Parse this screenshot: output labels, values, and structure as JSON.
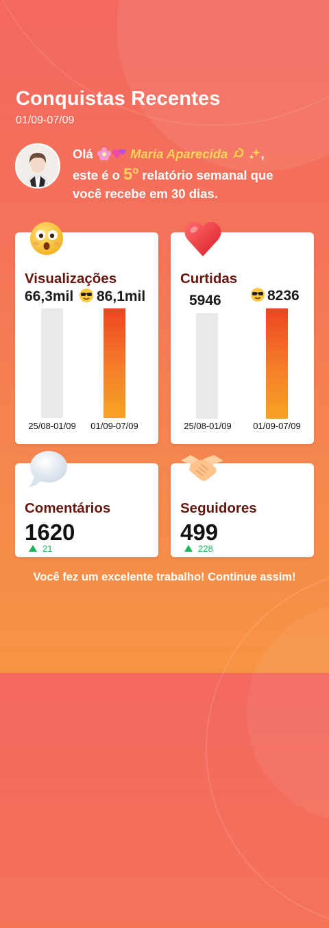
{
  "header": {
    "title": "Conquistas Recentes",
    "date_range": "01/09-07/09"
  },
  "greeting": {
    "hello": "Olá",
    "user_name": "Maria Aparecida",
    "line2_prefix": "este é o",
    "rank": "5º",
    "line2_suffix": "relatório semanal que",
    "line3": "você recebe em 30 dias."
  },
  "cards": {
    "views": {
      "label": "Visualizações",
      "prev_value": "66,3mil",
      "curr_value": "86,1mil",
      "prev_period": "25/08-01/09",
      "curr_period": "01/09-07/09",
      "icon": "surprised-face-icon"
    },
    "likes": {
      "label": "Curtidas",
      "prev_value": "5946",
      "curr_value": "8236",
      "prev_period": "25/08-01/09",
      "curr_period": "01/09-07/09",
      "icon": "heart-icon"
    },
    "comments": {
      "label": "Comentários",
      "value": "1620",
      "delta": "21",
      "icon": "speech-bubble-icon"
    },
    "followers": {
      "label": "Seguidores",
      "value": "499",
      "delta": "228",
      "icon": "handshake-icon"
    }
  },
  "footer": {
    "message": "Você fez um excelente trabalho! Continue assim!"
  },
  "colors": {
    "accent_text": "#66150e",
    "highlight": "#ffd35a",
    "positive": "#1fb457",
    "bar_current": "#ee4521",
    "bar_previous": "#e9e9ea"
  }
}
